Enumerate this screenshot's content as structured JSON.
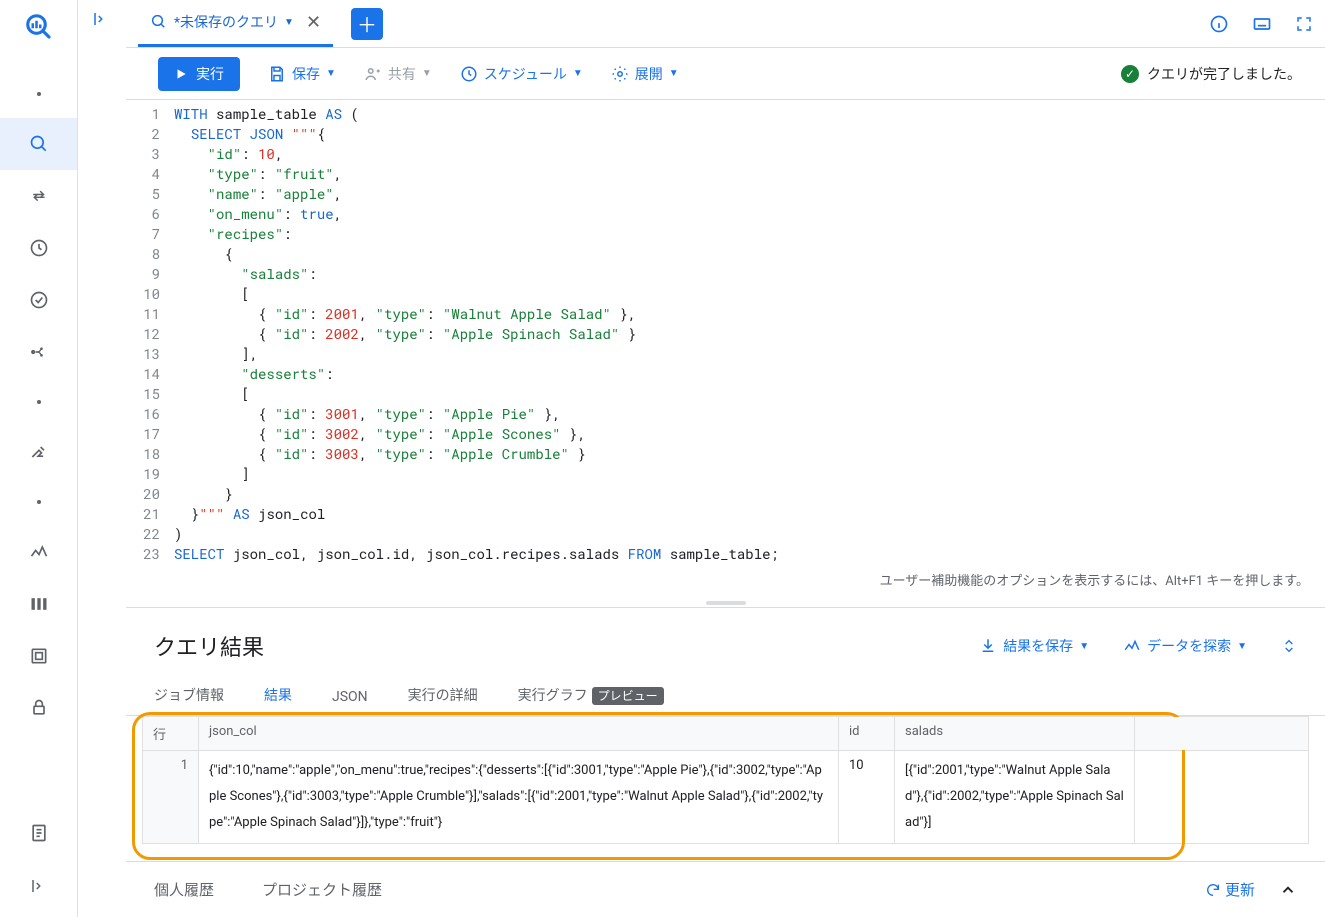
{
  "tab": {
    "title": "*未保存のクエリ"
  },
  "toolbar": {
    "run": "実行",
    "save": "保存",
    "share": "共有",
    "schedule": "スケジュール",
    "expand": "展開",
    "status": "クエリが完了しました。"
  },
  "editor": {
    "a11y_hint": "ユーザー補助機能のオプションを表示するには、Alt+F1 キーを押します。",
    "lines": [
      {
        "n": 1,
        "html": "<span class='k-blue'>WITH</span> sample_table <span class='k-blue'>AS</span> <span>(</span>"
      },
      {
        "n": 2,
        "html": "  <span class='k-blue'>SELECT</span> <span class='k-blue'>JSON</span> <span class='k-red'>\"\"\"</span>{"
      },
      {
        "n": 3,
        "html": "    <span class='k-green'>\"id\"</span>: <span class='k-red'>10</span>,"
      },
      {
        "n": 4,
        "html": "    <span class='k-green'>\"type\"</span>: <span class='k-green'>\"fruit\"</span>,"
      },
      {
        "n": 5,
        "html": "    <span class='k-green'>\"name\"</span>: <span class='k-green'>\"apple\"</span>,"
      },
      {
        "n": 6,
        "html": "    <span class='k-green'>\"on_menu\"</span>: <span class='k-blue'>true</span>,"
      },
      {
        "n": 7,
        "html": "    <span class='k-green'>\"recipes\"</span>:"
      },
      {
        "n": 8,
        "html": "      {"
      },
      {
        "n": 9,
        "html": "        <span class='k-green'>\"salads\"</span>:"
      },
      {
        "n": 10,
        "html": "        ["
      },
      {
        "n": 11,
        "html": "          { <span class='k-green'>\"id\"</span>: <span class='k-red'>2001</span>, <span class='k-green'>\"type\"</span>: <span class='k-green'>\"Walnut Apple Salad\"</span> },"
      },
      {
        "n": 12,
        "html": "          { <span class='k-green'>\"id\"</span>: <span class='k-red'>2002</span>, <span class='k-green'>\"type\"</span>: <span class='k-green'>\"Apple Spinach Salad\"</span> }"
      },
      {
        "n": 13,
        "html": "        ],"
      },
      {
        "n": 14,
        "html": "        <span class='k-green'>\"desserts\"</span>:"
      },
      {
        "n": 15,
        "html": "        ["
      },
      {
        "n": 16,
        "html": "          { <span class='k-green'>\"id\"</span>: <span class='k-red'>3001</span>, <span class='k-green'>\"type\"</span>: <span class='k-green'>\"Apple Pie\"</span> },"
      },
      {
        "n": 17,
        "html": "          { <span class='k-green'>\"id\"</span>: <span class='k-red'>3002</span>, <span class='k-green'>\"type\"</span>: <span class='k-green'>\"Apple Scones\"</span> },"
      },
      {
        "n": 18,
        "html": "          { <span class='k-green'>\"id\"</span>: <span class='k-red'>3003</span>, <span class='k-green'>\"type\"</span>: <span class='k-green'>\"Apple Crumble\"</span> }"
      },
      {
        "n": 19,
        "html": "        ]"
      },
      {
        "n": 20,
        "html": "      }"
      },
      {
        "n": 21,
        "html": "  }<span class='k-red'>\"\"\"</span> <span class='k-blue'>AS</span> json_col"
      },
      {
        "n": 22,
        "html": ")"
      },
      {
        "n": 23,
        "html": "<span class='k-blue'>SELECT</span> json_col, json_col.id, json_col.recipes.salads <span class='k-blue'>FROM</span> sample_table;"
      }
    ]
  },
  "results": {
    "title": "クエリ結果",
    "save_results": "結果を保存",
    "explore": "データを探索",
    "tabs": {
      "job_info": "ジョブ情報",
      "result": "結果",
      "json": "JSON",
      "exec_detail": "実行の詳細",
      "exec_graph": "実行グラフ",
      "preview_badge": "プレビュー"
    },
    "columns": [
      "行",
      "json_col",
      "id",
      "salads",
      ""
    ],
    "row_number": "1",
    "json_col_value": "{\"id\":10,\"name\":\"apple\",\"on_menu\":true,\"recipes\":{\"desserts\":[{\"id\":3001,\"type\":\"Apple Pie\"},{\"id\":3002,\"type\":\"Apple Scones\"},{\"id\":3003,\"type\":\"Apple Crumble\"}],\"salads\":[{\"id\":2001,\"type\":\"Walnut Apple Salad\"},{\"id\":2002,\"type\":\"Apple Spinach Salad\"}]},\"type\":\"fruit\"}",
    "id_value": "10",
    "salads_value": "[{\"id\":2001,\"type\":\"Walnut Apple Salad\"},{\"id\":2002,\"type\":\"Apple Spinach Salad\"}]"
  },
  "footer": {
    "personal": "個人履歴",
    "project": "プロジェクト履歴",
    "refresh": "更新"
  }
}
